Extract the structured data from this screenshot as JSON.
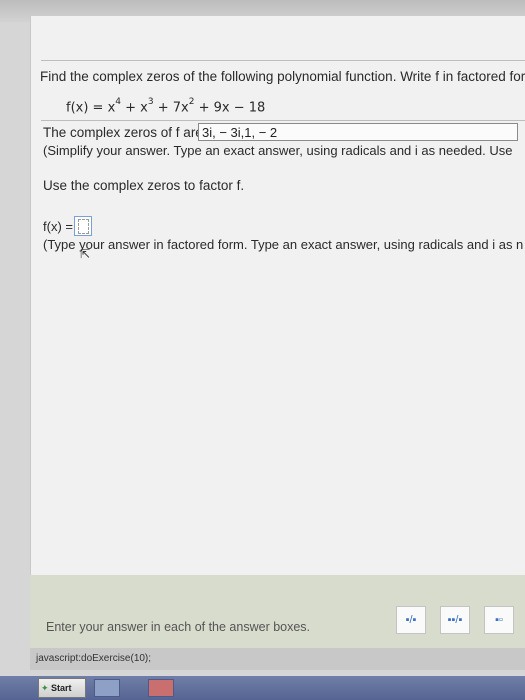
{
  "problem": {
    "instruction": "Find the complex zeros of the following polynomial function. Write f in factored form.",
    "function_lhs": "f(x) = ",
    "terms": [
      {
        "base": "x",
        "exp": "4"
      },
      {
        "base": " + x",
        "exp": "3"
      },
      {
        "base": " + 7x",
        "exp": "2"
      }
    ],
    "function_tail": " + 9x − 18"
  },
  "zeros": {
    "label": "The complex zeros of f are",
    "answer": "3i, − 3i,1, − 2",
    "hint": "(Simplify your answer. Type an exact answer, using radicals and i as needed. Use"
  },
  "factor": {
    "instruction": "Use the complex zeros to factor f.",
    "label": "f(x) =",
    "hint": "(Type your answer in factored form. Type an exact answer, using radicals and i as n"
  },
  "footer": {
    "prompt": "Enter your answer in each of the answer boxes.",
    "status": "javascript:doExercise(10);"
  },
  "tools": [
    {
      "icon": "fraction-icon",
      "glyph": "▪/▪"
    },
    {
      "icon": "mixed-number-icon",
      "glyph": "▪▪/▪"
    },
    {
      "icon": "exponent-icon",
      "glyph": "▪▫"
    }
  ],
  "taskbar": {
    "start_label": "Start"
  }
}
